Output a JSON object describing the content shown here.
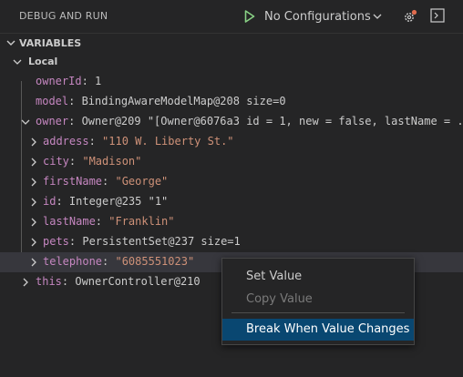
{
  "header": {
    "title": "DEBUG AND RUN",
    "config_label": "No Configurations",
    "accent_play": "#89d185",
    "accent_gear": "#e06c4e"
  },
  "variables": {
    "title": "VARIABLES",
    "scope_label": "Local",
    "rows": [
      {
        "key": "ownerId",
        "value": "1"
      },
      {
        "key": "model",
        "value": "BindingAwareModelMap@208 size=0"
      },
      {
        "key": "owner",
        "value": "Owner@209 \"[Owner@6076a3 id = 1, new = false, lastName = ..."
      },
      {
        "key": "address",
        "value": "\"110 W. Liberty St.\""
      },
      {
        "key": "city",
        "value": "\"Madison\""
      },
      {
        "key": "firstName",
        "value": "\"George\""
      },
      {
        "key": "id",
        "value": "Integer@235 \"1\""
      },
      {
        "key": "lastName",
        "value": "\"Franklin\""
      },
      {
        "key": "pets",
        "value": "PersistentSet@237 size=1"
      },
      {
        "key": "telephone",
        "value": "\"6085551023\""
      },
      {
        "key": "this",
        "value": "OwnerController@210"
      }
    ]
  },
  "context_menu": {
    "set_value": "Set Value",
    "copy_value": "Copy Value",
    "break_when_changes": "Break When Value Changes",
    "highlight_color": "#094771"
  }
}
